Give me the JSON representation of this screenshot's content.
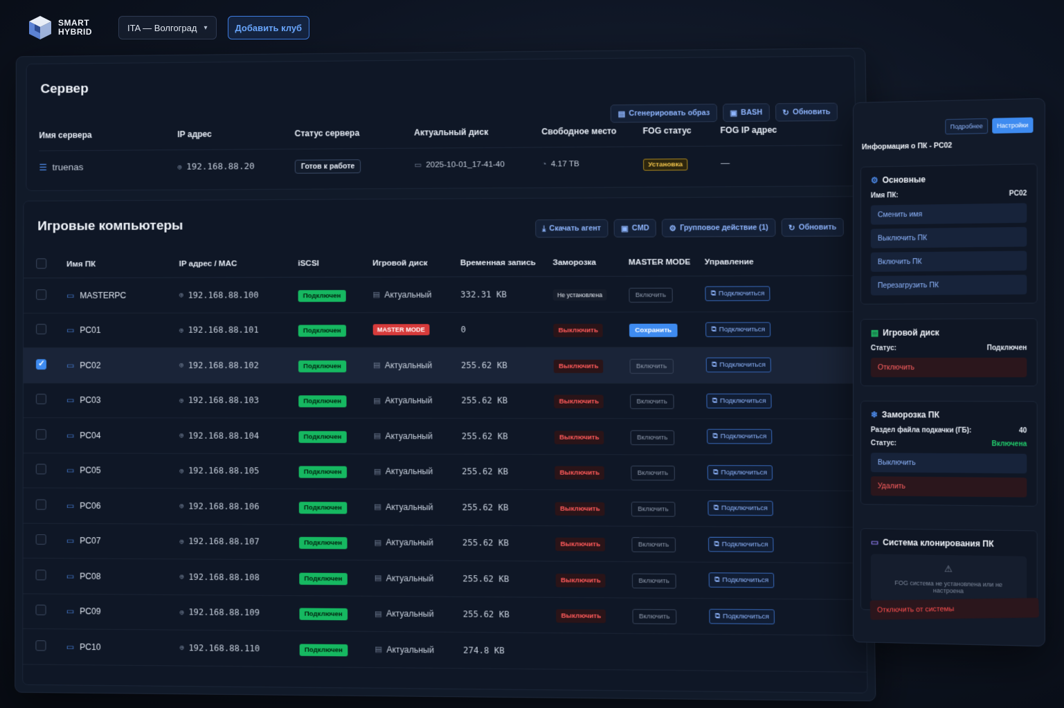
{
  "brand": {
    "line1": "SMART",
    "line2": "HYBRID"
  },
  "header": {
    "club": "ITA — Волгоград",
    "add_club": "Добавить клуб"
  },
  "server": {
    "title": "Сервер",
    "buttons": {
      "generate": "Сгенерировать образ",
      "bash": "BASH",
      "refresh": "Обновить"
    },
    "columns": [
      "Имя сервера",
      "IP адрес",
      "Статус сервера",
      "Актуальный диск",
      "Свободное место",
      "FOG статус",
      "FOG IP адрес"
    ],
    "row": {
      "name": "truenas",
      "ip": "192.168.88.20",
      "status": "Готов к работе",
      "disk": "2025-10-01_17-41-40",
      "free": "4.17 TB",
      "fog_status": "Установка",
      "fog_ip": "—"
    }
  },
  "pcs": {
    "title": "Игровые компьютеры",
    "buttons": {
      "download": "Скачать агент",
      "cmd": "CMD",
      "group": "Групповое действие (1)",
      "refresh": "Обновить"
    },
    "columns": [
      "Имя ПК",
      "IP адрес / MAC",
      "iSCSI",
      "Игровой диск",
      "Временная запись",
      "Заморозка",
      "MASTER MODE",
      "Управление"
    ],
    "rows": [
      {
        "name": "MASTERPC",
        "ip": "192.168.88.100",
        "iscsi": "Подключен",
        "disk": "Актуальный",
        "temp": "332.31 KB",
        "freeze": "Не установлена",
        "mm": "Включить",
        "ctl": "Подключиться",
        "checked": false
      },
      {
        "name": "PC01",
        "ip": "192.168.88.101",
        "iscsi": "Подключен",
        "disk": "MASTER MODE",
        "temp": "0",
        "freeze": "Выключить",
        "mm": "Сохранить",
        "ctl": "Подключиться",
        "checked": false
      },
      {
        "name": "PC02",
        "ip": "192.168.88.102",
        "iscsi": "Подключен",
        "disk": "Актуальный",
        "temp": "255.62 KB",
        "freeze": "Выключить",
        "mm": "Включить",
        "ctl": "Подключиться",
        "checked": true
      },
      {
        "name": "PC03",
        "ip": "192.168.88.103",
        "iscsi": "Подключен",
        "disk": "Актуальный",
        "temp": "255.62 KB",
        "freeze": "Выключить",
        "mm": "Включить",
        "ctl": "Подключиться",
        "checked": false
      },
      {
        "name": "PC04",
        "ip": "192.168.88.104",
        "iscsi": "Подключен",
        "disk": "Актуальный",
        "temp": "255.62 KB",
        "freeze": "Выключить",
        "mm": "Включить",
        "ctl": "Подключиться",
        "checked": false
      },
      {
        "name": "PC05",
        "ip": "192.168.88.105",
        "iscsi": "Подключен",
        "disk": "Актуальный",
        "temp": "255.62 KB",
        "freeze": "Выключить",
        "mm": "Включить",
        "ctl": "Подключиться",
        "checked": false
      },
      {
        "name": "PC06",
        "ip": "192.168.88.106",
        "iscsi": "Подключен",
        "disk": "Актуальный",
        "temp": "255.62 KB",
        "freeze": "Выключить",
        "mm": "Включить",
        "ctl": "Подключиться",
        "checked": false
      },
      {
        "name": "PC07",
        "ip": "192.168.88.107",
        "iscsi": "Подключен",
        "disk": "Актуальный",
        "temp": "255.62 KB",
        "freeze": "Выключить",
        "mm": "Включить",
        "ctl": "Подключиться",
        "checked": false
      },
      {
        "name": "PC08",
        "ip": "192.168.88.108",
        "iscsi": "Подключен",
        "disk": "Актуальный",
        "temp": "255.62 KB",
        "freeze": "Выключить",
        "mm": "Включить",
        "ctl": "Подключиться",
        "checked": false
      },
      {
        "name": "PC09",
        "ip": "192.168.88.109",
        "iscsi": "Подключен",
        "disk": "Актуальный",
        "temp": "255.62 KB",
        "freeze": "Выключить",
        "mm": "Включить",
        "ctl": "Подключиться",
        "checked": false
      },
      {
        "name": "PC10",
        "ip": "192.168.88.110",
        "iscsi": "Подключен",
        "disk": "Актуальный",
        "temp": "274.8 KB",
        "freeze": "",
        "mm": "",
        "ctl": "",
        "checked": false
      }
    ]
  },
  "side": {
    "tab_more": "Подробнее",
    "tab_settings": "Настройки",
    "title": "Информация о ПК - PC02",
    "basic": {
      "title": "Основные",
      "name_label": "Имя ПК:",
      "name_value": "PC02",
      "actions": [
        "Сменить имя",
        "Выключить ПК",
        "Включить ПК",
        "Перезагрузить ПК"
      ]
    },
    "disk": {
      "title": "Игровой диск",
      "status_label": "Статус:",
      "status_value": "Подключен",
      "disconnect": "Отключить"
    },
    "freeze": {
      "title": "Заморозка ПК",
      "swap_label": "Раздел файла подкачки (ГБ):",
      "swap_value": "40",
      "status_label": "Статус:",
      "status_value": "Включена",
      "off": "Выключить",
      "delete": "Удалить"
    },
    "clone": {
      "title": "Система клонирования ПК",
      "message": "FOG система не установлена или не настроена"
    },
    "detach": "Отключить от системы"
  },
  "colors": {
    "accent": "#3e8bf0",
    "success": "#16b861",
    "danger": "#ff5a5a",
    "warning": "#f1c34a"
  }
}
